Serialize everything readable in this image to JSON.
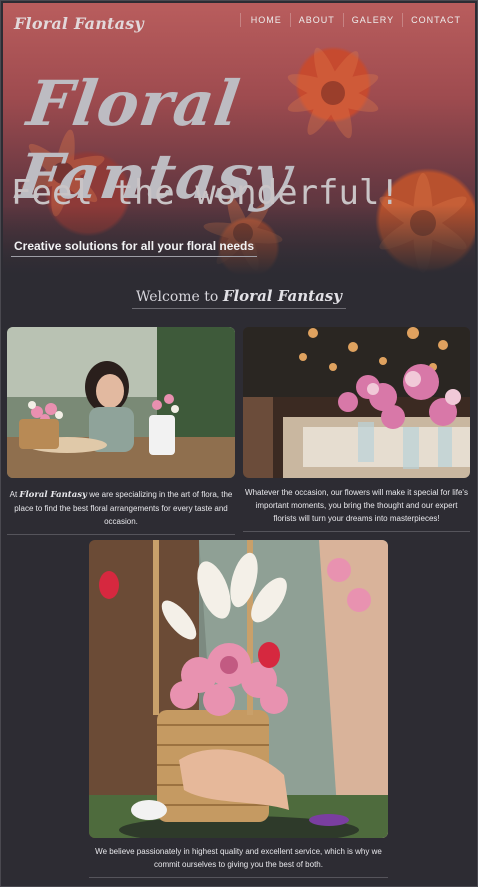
{
  "header": {
    "brand": "Floral Fantasy",
    "nav": [
      "HOME",
      "ABOUT",
      "GALERY",
      "CONTACT"
    ]
  },
  "hero": {
    "title": "Floral Fantasy",
    "subtitle": "Feel the wonderful!",
    "tagline": "Creative solutions for all your floral needs"
  },
  "welcome": {
    "prefix": "Welcome to",
    "brand": "Floral Fantasy"
  },
  "cards": [
    {
      "caption_prefix": "At",
      "caption_brand": "Floral Fantasy",
      "caption_rest": "we are specializing in the art of flora, the place to find the best floral arrangements for every taste and occasion."
    },
    {
      "caption": "Whatever the occasion, our flowers will make it special for life's important moments, you bring the thought and our expert florists will turn your dreams into masterpieces!"
    },
    {
      "caption": "We believe passionately in highest quality and excellent service, which is why we commit ourselves to giving you the best of both."
    }
  ]
}
